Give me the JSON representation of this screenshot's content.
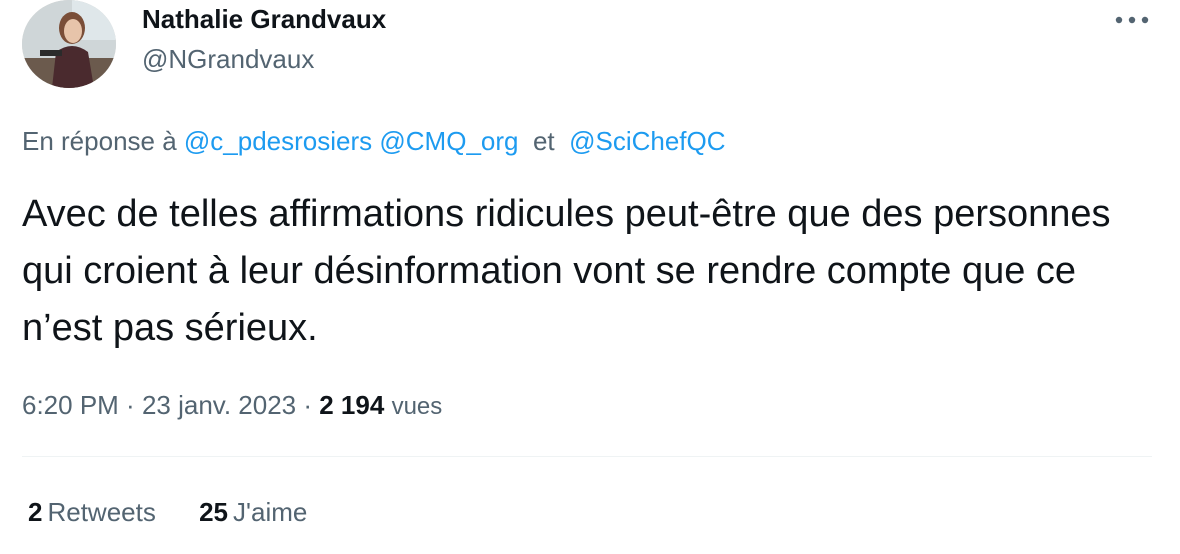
{
  "author": {
    "name": "Nathalie Grandvaux",
    "handle": "@NGrandvaux",
    "avatar_alt": "profile photo"
  },
  "menu": {
    "more_icon": "more-horizontal-icon"
  },
  "reply": {
    "prefix": "En réponse à",
    "mention_1": "@c_pdesrosiers",
    "mention_2": "@CMQ_org",
    "conjunction": "et",
    "mention_3": "@SciChefQC"
  },
  "tweet": {
    "text": "Avec de telles affirmations ridicules peut-être que des personnes qui croient à leur désinformation vont se rendre compte que ce n’est pas sérieux."
  },
  "meta": {
    "time": "6:20 PM",
    "sep1": " · ",
    "date": "23 janv. 2023",
    "sep2": " · ",
    "views_count": "2 194",
    "views_label": "vues"
  },
  "stats": {
    "retweets_count": "2",
    "retweets_label": "Retweets",
    "likes_count": "25",
    "likes_label": "J'aime"
  },
  "colors": {
    "link": "#1d9bf0",
    "secondary_text": "#536471",
    "primary_text": "#0f1419",
    "divider": "#eff3f4"
  }
}
